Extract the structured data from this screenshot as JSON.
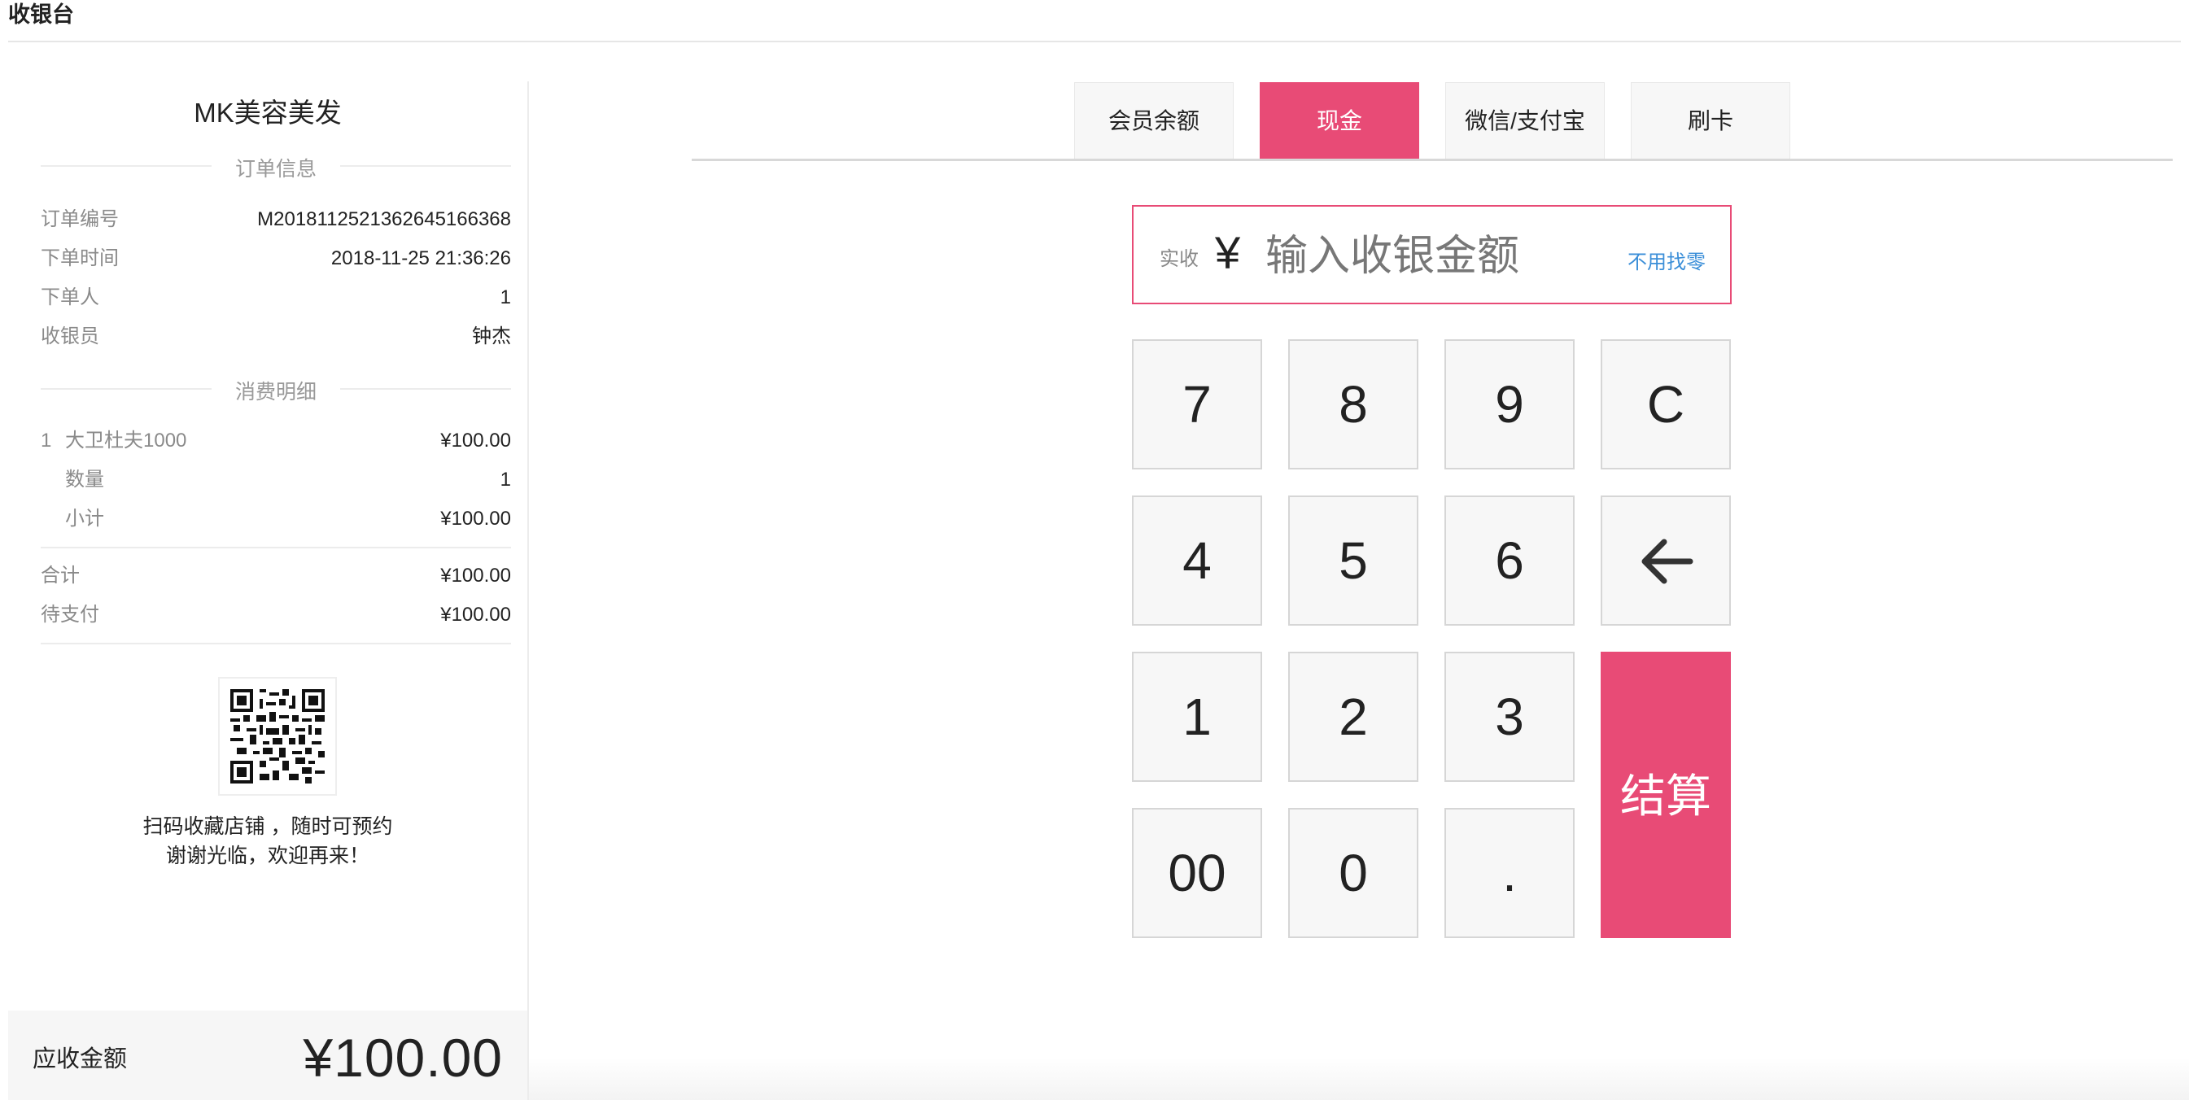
{
  "header": {
    "title": "收银台"
  },
  "receipt": {
    "shop_name": "MK美容美发",
    "order_section": "订单信息",
    "order_rows": [
      {
        "label": "订单编号",
        "value": "M201811252136264516636​8"
      },
      {
        "label": "下单时间",
        "value": "2018-11-25 21:36:26"
      },
      {
        "label": "下单人",
        "value": "1"
      },
      {
        "label": "收银员",
        "value": "钟杰"
      }
    ],
    "detail_section": "消费明细",
    "item": {
      "index": "1",
      "name": "大卫杜夫1000",
      "price": "¥100.00",
      "qty_label": "数量",
      "qty": "1",
      "subtotal_label": "小计",
      "subtotal": "¥100.00"
    },
    "total_label": "合计",
    "total": "¥100.00",
    "pending_label": "待支付",
    "pending": "¥100.00",
    "qr_note_1": "扫码收藏店铺 ，随时可预约",
    "qr_note_2": "谢谢光临，欢迎再来！",
    "due_label": "应收金额",
    "due_amount": "¥100.00"
  },
  "payment": {
    "tabs": [
      {
        "label": "会员余额",
        "active": false
      },
      {
        "label": "现金",
        "active": true
      },
      {
        "label": "微信/支付宝",
        "active": false
      },
      {
        "label": "刷卡",
        "active": false
      }
    ],
    "received_label": "实收",
    "currency": "¥",
    "amount_placeholder": "输入收银金额",
    "no_change": "不用找零",
    "keys": [
      "7",
      "8",
      "9",
      "C",
      "4",
      "5",
      "6",
      "1",
      "2",
      "3",
      "00",
      "0",
      "."
    ],
    "backspace_icon": "arrow-left-icon",
    "settle_label": "结算"
  },
  "colors": {
    "accent": "#e84b76",
    "link": "#3a8ed8"
  }
}
